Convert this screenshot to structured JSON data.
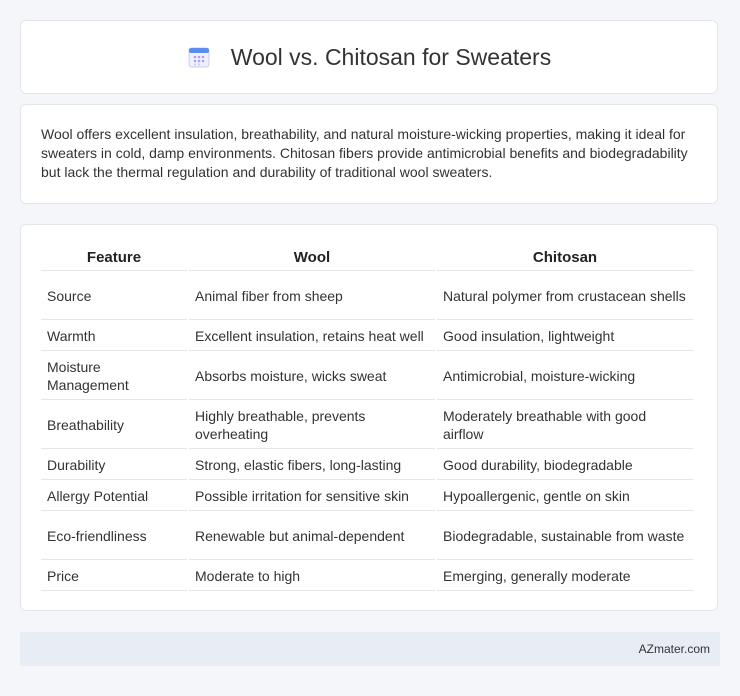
{
  "header": {
    "title": "Wool vs. Chitosan for Sweaters",
    "icon": "calendar-icon"
  },
  "description": "Wool offers excellent insulation, breathability, and natural moisture-wicking properties, making it ideal for sweaters in cold, damp environments. Chitosan fibers provide antimicrobial benefits and biodegradability but lack the thermal regulation and durability of traditional wool sweaters.",
  "table": {
    "headers": [
      "Feature",
      "Wool",
      "Chitosan"
    ],
    "rows": [
      [
        "Source",
        "Animal fiber from sheep",
        "Natural polymer from crustacean shells"
      ],
      [
        "Warmth",
        "Excellent insulation, retains heat well",
        "Good insulation, lightweight"
      ],
      [
        "Moisture Management",
        "Absorbs moisture, wicks sweat",
        "Antimicrobial, moisture-wicking"
      ],
      [
        "Breathability",
        "Highly breathable, prevents overheating",
        "Moderately breathable with good airflow"
      ],
      [
        "Durability",
        "Strong, elastic fibers, long-lasting",
        "Good durability, biodegradable"
      ],
      [
        "Allergy Potential",
        "Possible irritation for sensitive skin",
        "Hypoallergenic, gentle on skin"
      ],
      [
        "Eco-friendliness",
        "Renewable but animal-dependent",
        "Biodegradable, sustainable from waste"
      ],
      [
        "Price",
        "Moderate to high",
        "Emerging, generally moderate"
      ]
    ]
  },
  "footer": {
    "site": "AZmater.com"
  },
  "colors": {
    "page_bg": "#f4f6f9",
    "card_bg": "#ffffff",
    "footer_bg": "#e7ecf5",
    "icon_accent": "#5b8def",
    "icon_dots": "#b49cf0"
  }
}
